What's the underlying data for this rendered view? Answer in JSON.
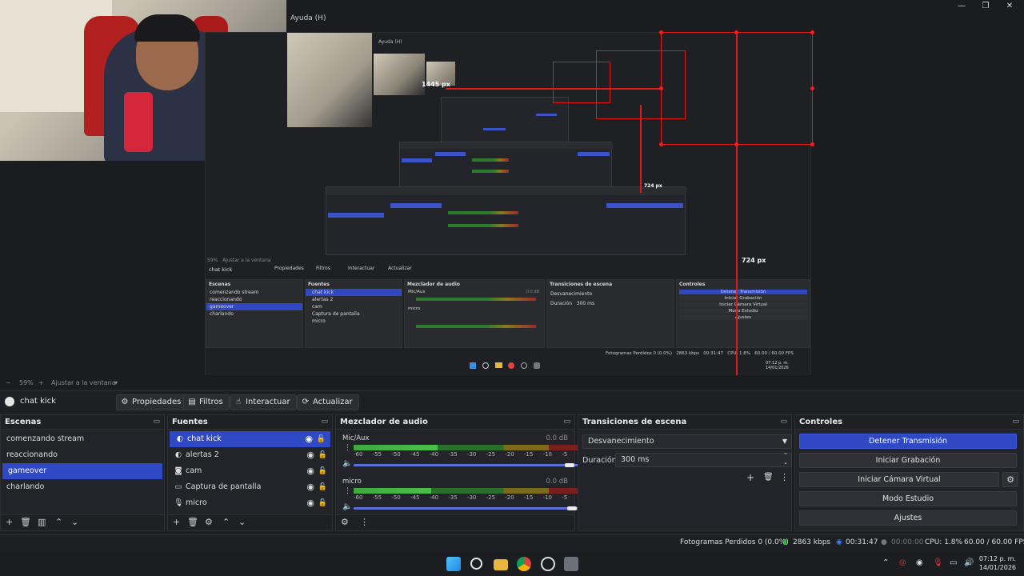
{
  "window": {
    "help_title": "Ayuda (H)",
    "controls": {
      "minimize": "—",
      "maximize": "❐",
      "close": "✕"
    }
  },
  "preview": {
    "nested_help_title": "Ayuda (H)",
    "measure_1445": "1445 px",
    "measure_724_small": "724 px",
    "measure_724": "724 px",
    "nested_scene": "chat kick",
    "nested_buttons": [
      "Propiedades",
      "Filtros",
      "Interactuar",
      "Actualizar"
    ],
    "nested_zoom": "59%",
    "nested_zoom_fit": "Ajustar a la ventana",
    "nested_docks": {
      "scenes_title": "Escenas",
      "scenes": [
        "comenzando stream",
        "reaccionando",
        "gameover",
        "charlando"
      ],
      "sources_title": "Fuentes",
      "sources": [
        "chat kick",
        "alertas 2",
        "cam",
        "Captura de pantalla",
        "micro"
      ],
      "mixer_title": "Mezclador de audio",
      "mixer_channels": [
        "Mic/Aux",
        "micro"
      ],
      "mixer_db": "0.0 dB",
      "transitions_title": "Transiciones de escena",
      "transition": "Desvanecimiento",
      "duration_label": "Duración",
      "duration": "300 ms",
      "controls_title": "Controles",
      "controls": [
        "Detener Transmisión",
        "Iniciar Grabación",
        "Iniciar Cámara Virtual",
        "Modo Estudio",
        "Ajustes"
      ],
      "status": "Fotogramas Perdidos 0 (0.0%)",
      "kbps": "2863 kbps",
      "time": "00:31:47",
      "cpu": "CPU: 1.8%",
      "fps": "60.00 / 60.00 FPS",
      "clock_time": "07:12 p. m.",
      "clock_date": "14/01/2026"
    }
  },
  "zoombar": {
    "minus": "−",
    "zoom": "59%",
    "plus": "+",
    "fit": "Ajustar a la ventana",
    "caret": "▾"
  },
  "source_toolbar": {
    "current_source": "chat kick",
    "properties": "Propiedades",
    "filters": "Filtros",
    "interact": "Interactuar",
    "refresh": "Actualizar"
  },
  "scenes": {
    "title": "Escenas",
    "items": [
      "comenzando stream",
      "reaccionando",
      "gameover",
      "charlando"
    ],
    "selected_index": 2
  },
  "sources": {
    "title": "Fuentes",
    "items": [
      {
        "label": "chat kick",
        "icon": "browser-icon"
      },
      {
        "label": "alertas 2",
        "icon": "browser-icon"
      },
      {
        "label": "cam",
        "icon": "camera-icon"
      },
      {
        "label": "Captura de pantalla",
        "icon": "monitor-icon"
      },
      {
        "label": "micro",
        "icon": "microphone-icon"
      }
    ],
    "selected_index": 0
  },
  "mixer": {
    "title": "Mezclador de audio",
    "channels": [
      {
        "name": "Mic/Aux",
        "db": "0.0 dB",
        "level": 0.37,
        "volume": 0.97
      },
      {
        "name": "micro",
        "db": "0.0 dB",
        "level": 0.34,
        "volume": 0.98
      }
    ],
    "ticks": [
      "-60",
      "-55",
      "-50",
      "-45",
      "-40",
      "-35",
      "-30",
      "-25",
      "-20",
      "-15",
      "-10",
      "-5",
      "0"
    ]
  },
  "transitions": {
    "title": "Transiciones de escena",
    "selected": "Desvanecimiento",
    "duration_label": "Duración",
    "duration": "300 ms"
  },
  "controls": {
    "title": "Controles",
    "stop_stream": "Detener Transmisión",
    "start_recording": "Iniciar Grabación",
    "start_virtual_cam": "Iniciar Cámara Virtual",
    "studio_mode": "Modo Estudio",
    "settings": "Ajustes"
  },
  "status": {
    "dropped_frames": "Fotogramas Perdidos 0 (0.0%)",
    "bitrate": "2863 kbps",
    "stream_time": "00:31:47",
    "rec_time": "00:00:00",
    "cpu": "CPU: 1.8%",
    "fps": "60.00 / 60.00 FPS"
  },
  "taskbar": {
    "time": "07:12 p. m.",
    "date": "14/01/2026"
  },
  "colors": {
    "accent": "#2f48c4",
    "panel": "#23242a",
    "measure": "#e01818"
  }
}
